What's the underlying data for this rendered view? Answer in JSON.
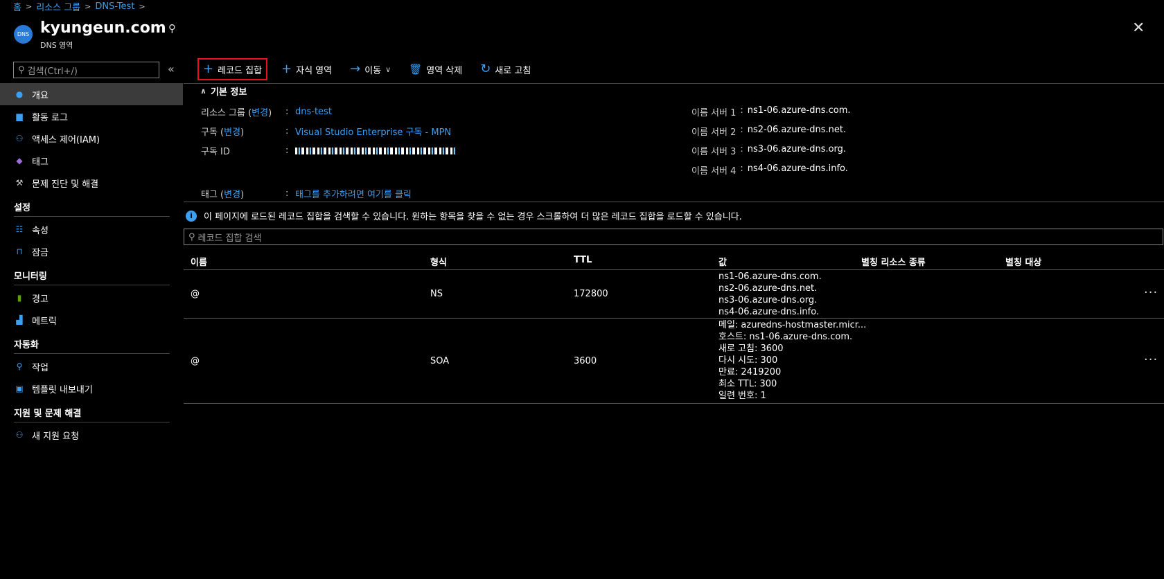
{
  "breadcrumb": [
    "홈",
    "리소스 그룹",
    "DNS-Test"
  ],
  "header": {
    "icon_text": "DNS",
    "title": "kyungeun.com",
    "subtitle": "DNS 영역",
    "pin": "⚲",
    "close": "✕"
  },
  "sidebar": {
    "search_placeholder": "검색(Ctrl+/)",
    "collapse": "«",
    "top_items": [
      {
        "label": "개요"
      },
      {
        "label": "활동 로그"
      },
      {
        "label": "액세스 제어(IAM)"
      },
      {
        "label": "태그"
      },
      {
        "label": "문제 진단 및 해결"
      }
    ],
    "groups": [
      {
        "title": "설정",
        "items": [
          {
            "label": "속성"
          },
          {
            "label": "잠금"
          }
        ]
      },
      {
        "title": "모니터링",
        "items": [
          {
            "label": "경고"
          },
          {
            "label": "메트릭"
          }
        ]
      },
      {
        "title": "자동화",
        "items": [
          {
            "label": "작업"
          },
          {
            "label": "템플릿 내보내기"
          }
        ]
      },
      {
        "title": "지원 및 문제 해결",
        "items": [
          {
            "label": "새 지원 요청"
          }
        ]
      }
    ]
  },
  "toolbar": {
    "record_set": "레코드 집합",
    "child_zone": "자식 영역",
    "move": "이동",
    "delete_zone": "영역 삭제",
    "refresh": "새로 고침"
  },
  "essentials": {
    "title": "기본 정보",
    "change": "변경",
    "resource_group_label": "리소스 그룹",
    "resource_group_value": "dns-test",
    "subscription_label": "구독",
    "subscription_value": "Visual Studio Enterprise 구독 - MPN",
    "subscription_id_label": "구독 ID",
    "tags_label": "태그",
    "tags_value": "태그를 추가하려면 여기를 클릭",
    "name_servers": [
      {
        "label": "이름 서버 1",
        "value": "ns1-06.azure-dns.com."
      },
      {
        "label": "이름 서버 2",
        "value": "ns2-06.azure-dns.net."
      },
      {
        "label": "이름 서버 3",
        "value": "ns3-06.azure-dns.org."
      },
      {
        "label": "이름 서버 4",
        "value": "ns4-06.azure-dns.info."
      }
    ]
  },
  "info_message": "이 페이지에 로드된 레코드 집합을 검색할 수 있습니다. 원하는 항목을 찾을 수 없는 경우 스크롤하여 더 많은 레코드 집합을 로드할 수 있습니다.",
  "record_search_placeholder": "레코드 집합 검색",
  "table": {
    "columns": [
      "이름",
      "형식",
      "TTL",
      "값",
      "별칭 리소스 종류",
      "별칭 대상"
    ],
    "rows": [
      {
        "name": "@",
        "type": "NS",
        "ttl": "172800",
        "values": [
          "ns1-06.azure-dns.com.",
          "ns2-06.azure-dns.net.",
          "ns3-06.azure-dns.org.",
          "ns4-06.azure-dns.info."
        ]
      },
      {
        "name": "@",
        "type": "SOA",
        "ttl": "3600",
        "values": [
          "메일: azuredns-hostmaster.micr...",
          "호스트: ns1-06.azure-dns.com.",
          "새로 고침: 3600",
          "다시 시도: 300",
          "만료: 2419200",
          "최소 TTL: 300",
          "일련 번호: 1"
        ]
      }
    ],
    "more": "···"
  },
  "colors": {
    "accent": "#3aa0f3",
    "highlight_border": "#e81123",
    "active_nav": "#3b3b3b",
    "background": "#000000"
  }
}
